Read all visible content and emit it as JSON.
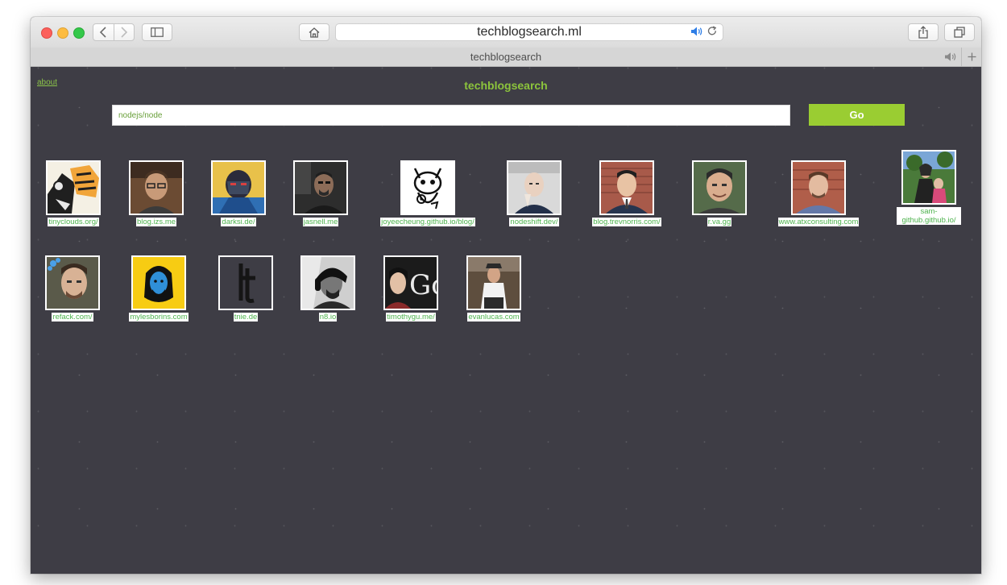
{
  "browser": {
    "url": "techblogsearch.ml",
    "tab_title": "techblogsearch"
  },
  "page": {
    "about_label": "about",
    "title": "techblogsearch",
    "search_value": "nodejs/node",
    "go_label": "Go"
  },
  "colors": {
    "accent": "#9acd32",
    "title": "#8cc43c",
    "link": "#4fb34f",
    "background": "#3e3d45"
  },
  "results": [
    {
      "label": "tinyclouds.org/"
    },
    {
      "label": "blog.izs.me"
    },
    {
      "label": "darksi.de/"
    },
    {
      "label": "jasnell.me"
    },
    {
      "label": "joyeecheung.github.io/blog/"
    },
    {
      "label": "nodeshift.dev/"
    },
    {
      "label": "blog.trevnorris.com/"
    },
    {
      "label": "r.va.gg"
    },
    {
      "label": "www.atxconsulting.com"
    },
    {
      "label": "sam-github.github.io/"
    },
    {
      "label": "refack.com/"
    },
    {
      "label": "mylesborins.com"
    },
    {
      "label": "tnie.de"
    },
    {
      "label": "n8.io"
    },
    {
      "label": "timothygu.me/"
    },
    {
      "label": "evanlucas.com"
    }
  ]
}
